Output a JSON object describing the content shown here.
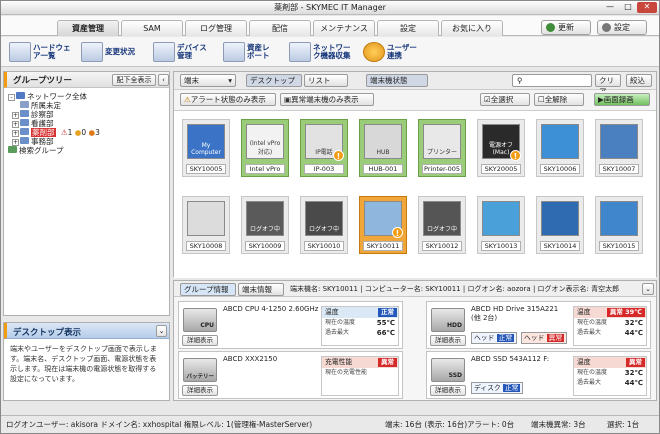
{
  "app": {
    "title": "薬剤部 - SKYMEC IT Manager"
  },
  "tabs": [
    "資産管理",
    "SAM",
    "ログ管理",
    "配信",
    "メンテナンス",
    "設定",
    "お気に入り"
  ],
  "top_buttons": {
    "refresh": "更新",
    "settings": "設定"
  },
  "toolbar": [
    "ハードウェア一覧",
    "変更状況",
    "デバイス管理",
    "資産レポート",
    "ネットワーク機器収集",
    "ユーザー連携"
  ],
  "group_tree": {
    "title": "グループツリー",
    "expand_all": "配下全表示",
    "nodes": [
      "ネットワーク全体",
      "所属未定",
      "診察部",
      "看護部",
      "薬剤部",
      "事務部",
      "検索グループ"
    ],
    "selected_counts": [
      "1",
      "0",
      "3"
    ]
  },
  "desktop_panel": {
    "title": "デスクトップ表示",
    "text": "端末やユーザーをデスクトップ画面で表示します。端末名、デスクトップ画面、電源状態を表示します。現在は端末機の電源状態を取得する設定になっています。"
  },
  "view_bar": {
    "mode": "端末",
    "desktop": "デスクトップ",
    "list": "リスト",
    "terminal_state": "端末機状態",
    "search_placeholder": "",
    "clear": "クリア",
    "filter": "絞込"
  },
  "filter_bar": {
    "alert_only": "アラート状態のみ表示",
    "abnormal_only": "異常端末機のみ表示",
    "select_all": "全選択",
    "deselect_all": "全解除",
    "screen_record": "画面録画"
  },
  "thumbs": [
    {
      "label": "SKY10005",
      "screen": "My Computer"
    },
    {
      "label": "Intel vPro",
      "screen": "(Intel vPro対応)"
    },
    {
      "label": "IP-003",
      "screen": "IP電話"
    },
    {
      "label": "HUB-001",
      "screen": "HUB"
    },
    {
      "label": "Printer-005",
      "screen": "プリンター"
    },
    {
      "label": "SKY20005",
      "screen": "電源オフ (Mac)"
    },
    {
      "label": "SKY10006",
      "screen": ""
    },
    {
      "label": "SKY10007",
      "screen": ""
    },
    {
      "label": "SKY10008",
      "screen": ""
    },
    {
      "label": "SKY10009",
      "screen": "ログオフ中"
    },
    {
      "label": "SKY10010",
      "screen": "ログオフ中"
    },
    {
      "label": "SKY10011",
      "screen": ""
    },
    {
      "label": "SKY10012",
      "screen": "ログオフ中"
    },
    {
      "label": "SKY10013",
      "screen": ""
    },
    {
      "label": "SKY10014",
      "screen": ""
    },
    {
      "label": "SKY10015",
      "screen": ""
    }
  ],
  "detail": {
    "group_info": "グループ情報",
    "terminal_info": "端末情報",
    "header_text": "端末機名: SKY10011 | コンピューター名: SKY10011 | ログオン名: aozora | ログオン表示名: 青空太郎",
    "detail_btn": "詳細表示",
    "cards": [
      {
        "icon": "CPU",
        "name": "ABCD CPU 4-1250 2.60GHz",
        "box_title": "温度",
        "box_state": "正常",
        "row1": "現在の温度",
        "val1": "55℃",
        "row2": "過去最大",
        "val2": "66℃"
      },
      {
        "icon": "HDD",
        "name": "ABCD HD Drive 315A221 (他 2台)",
        "tag1": "ヘッド",
        "tag1v": "正常",
        "tag2": "ヘッド",
        "tag2v": "異常",
        "box_title": "温度",
        "box_state": "異常 39℃",
        "row1": "現在の温度",
        "val1": "32℃",
        "row2": "過去最大",
        "val2": "44℃"
      },
      {
        "icon": "バッテリー",
        "name": "ABCD XXX2150",
        "box_title": "充電性能",
        "box_state": "異常",
        "row1": "現在の充電性能",
        "val1": ""
      },
      {
        "icon": "SSD",
        "name": "ABCD SSD 543A112 F:",
        "tag1": "ディスク",
        "tag1v": "正常",
        "box_title": "温度",
        "box_state": "異常",
        "row1": "現在の温度",
        "val1": "32℃",
        "row2": "過去最大",
        "val2": "44℃"
      }
    ]
  },
  "status": {
    "user": "ログオンユーザー: akisora ドメイン名: xxhospital 権限レベル: 1(管理権-MasterServer)",
    "terminals": "端末: 16台 (表示: 16台)",
    "alerts": "アラート: 0台",
    "abnormal": "端末機異常: 3台",
    "selected": "選択: 1台"
  },
  "colors": {
    "accent": "#f39c12",
    "ok": "#2557b8",
    "ng": "#d62a2a",
    "selected": "#f1a63a"
  }
}
